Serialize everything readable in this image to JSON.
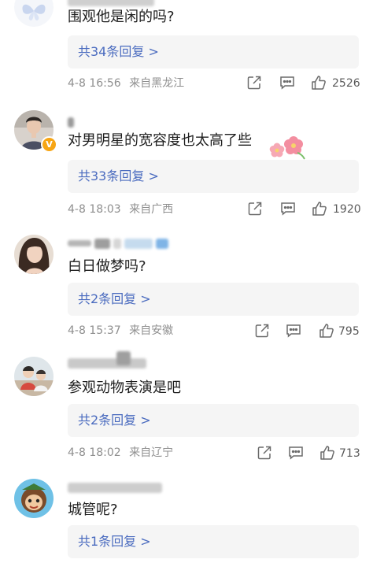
{
  "comments": [
    {
      "text": "围观他是闲的吗?",
      "reply_label": "共34条回复 >",
      "date": "4-8 16:56",
      "location": "来自黑龙江",
      "likes": "2526",
      "verified": false
    },
    {
      "text": "对男明星的宽容度也太高了些",
      "reply_label": "共33条回复 >",
      "date": "4-8 18:03",
      "location": "来自广西",
      "likes": "1920",
      "verified": true,
      "verified_badge": "V"
    },
    {
      "text": "白日做梦吗?",
      "reply_label": "共2条回复 >",
      "date": "4-8 15:37",
      "location": "来自安徽",
      "likes": "795",
      "verified": false
    },
    {
      "text": "参观动物表演是吧",
      "reply_label": "共2条回复 >",
      "date": "4-8 18:02",
      "location": "来自辽宁",
      "likes": "713",
      "verified": false
    },
    {
      "text": "城管呢?",
      "reply_label": "共1条回复 >",
      "date": "",
      "location": "",
      "likes": "",
      "verified": false
    }
  ],
  "icons": {
    "share": "share-icon",
    "comment": "comment-icon",
    "like": "thumbs-up-icon",
    "flower": "flower-icon"
  },
  "colors": {
    "link": "#4a6bbf",
    "meta": "#8f8f8f",
    "reply_bg": "#f5f5f5",
    "verified": "#f7a514"
  }
}
